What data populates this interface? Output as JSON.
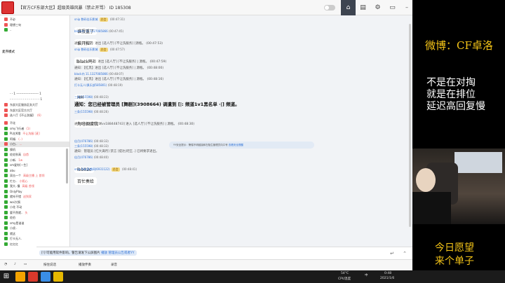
{
  "title": "【官方CF东部大区】超级英雄风暴（禁止开骂） ID 185308",
  "viewers": "5万",
  "tabs": [
    "home",
    "list",
    "tools",
    "info"
  ],
  "sidebar": {
    "top": [
      {
        "label": "不必",
        "icon": "#e55"
      },
      {
        "label": "理想三旬",
        "icon": "#e55"
      },
      {
        "label": "..",
        "icon": "#3a3"
      }
    ],
    "section_label": "麦序模式",
    "lines": [
      "- - 1 ---------------------- 1",
      "- - - - - - - - - - - - - - - - 1"
    ],
    "channels": [
      {
        "label": "东部大区服务区务大厅",
        "icon": "#e55"
      },
      {
        "label": "东部大区官方大厅",
        "icon": "#e55"
      },
      {
        "label": "选人厅【不让洗服】",
        "icon": "#e55",
        "note": "(6)"
      }
    ],
    "members": [
      {
        "label": "不化",
        "icon": "#e55"
      },
      {
        "label": "smy飞行者",
        "icon": "#3a3",
        "note": "(1)"
      },
      {
        "label": "PL拉K哦",
        "icon": "#3a3",
        "note": "不让洗服 [麦]"
      },
      {
        "label": "阿福.",
        "icon": "#3a3",
        "note": "(..)"
      },
      {
        "label": "小白..",
        "icon": "#e55",
        "note": "...",
        "selected": true
      },
      {
        "label": "操机",
        "icon": "#3a3"
      },
      {
        "label": "佐佐秋高",
        "icon": "#3a3",
        "note": "自首"
      },
      {
        "label": "小新.",
        "icon": "#3a3",
        "note": "1w"
      },
      {
        "label": "sm爱你[一生]",
        "icon": "#3a3"
      },
      {
        "label": "abu",
        "icon": "#3a3"
      },
      {
        "label": "双击一个",
        "icon": "#3a3",
        "note": "高级主播 上 首领"
      },
      {
        "label": "忙乜..",
        "icon": "#3a3",
        "note": "小熙心"
      },
      {
        "label": "我大..慢",
        "icon": "#3a3",
        "note": "高级 首领"
      },
      {
        "label": "OnlyPlay",
        "icon": "#3a3"
      },
      {
        "label": "就咔不错",
        "icon": "#3a3",
        "note": "送到家"
      },
      {
        "label": "wai大锅",
        "icon": "#3a3"
      },
      {
        "label": "小花 不动",
        "icon": "#3a3"
      },
      {
        "label": "要不然就..",
        "icon": "#3a3",
        "note": "头"
      },
      {
        "label": "佐伯",
        "icon": "#3a3"
      },
      {
        "label": "smy是谁谁",
        "icon": "#3a3"
      },
      {
        "label": "小虎..",
        "icon": "#3a3"
      },
      {
        "label": "就这",
        "icon": "#3a3"
      },
      {
        "label": "打卡无人.",
        "icon": "#3a3"
      },
      {
        "label": "红红红",
        "icon": "#3a3"
      }
    ]
  },
  "chat": {
    "messages": [
      {
        "type": "meta",
        "name": "snip 数码佳乐影城",
        "badge": "总会",
        "time": "00:47:31"
      },
      {
        "type": "bubble",
        "text": "谁授重了"
      },
      {
        "type": "meta",
        "name": "black内 11.1327085866",
        "time": "00:47:45"
      },
      {
        "type": "bubble",
        "text": "谁开拉？"
      },
      {
        "type": "sys",
        "text": "通知：【快乐】进出 [选人厅] [不让洗服务] [源瓶。 (00:47:53)"
      },
      {
        "type": "meta",
        "name": "snip 数码佳乐影城",
        "badge": "总会",
        "time": "00:47:57"
      },
      {
        "type": "bubble",
        "text": "black吗？"
      },
      {
        "type": "sys",
        "text": "【1 1 8 .. 2 q】进出 [选人厅] [不让洗服务] | 源瓶。 (00:47:59)"
      },
      {
        "type": "sys",
        "text": "通知：【红黑】进出 [选人厅] [不让洗服务] | 源瓶。 (00:48:00)"
      },
      {
        "type": "meta",
        "name": "black内 11.1327085866",
        "time": "00:48:07"
      },
      {
        "type": "sys",
        "text": "通知：【红黑】进出 [选人厅] [不让洗服务] | 源瓶。 (00:48:16)"
      },
      {
        "type": "meta",
        "name": "打卡无人(俱乐部585801)",
        "badge": "",
        "time": "00:48:19"
      },
      {
        "type": "bubble",
        "text": "HH"
      },
      {
        "type": "meta",
        "name": "三条(155598)",
        "time": "00:48:23"
      },
      {
        "type": "notice",
        "text": "通知：您已经被管理员 [舞剧](3908664) 调遣到 [|:     频道1v1黑名单      ·|] 频道。"
      },
      {
        "type": "meta",
        "name": "三条(155598)",
        "time": "00:48:26"
      },
      {
        "type": "bubble",
        "text": "为啥调度我"
      },
      {
        "type": "sys",
        "text": "通知：[进入CF全球vv188448743] 进入 [选人厅] [不让洗服务] | 源瓶。 (00:48:30)"
      },
      {
        "type": "meta",
        "name": "佳月(476786)",
        "time": "00:48:33"
      },
      {
        "type": "meta",
        "name": "三条(155598)",
        "time": "00:48:33"
      },
      {
        "type": "sys",
        "text": "通知：管理员 [红大满月] 禁言 [提达|吧王..] 已将要求退出。"
      },
      {
        "type": "meta",
        "name": "佳月(476786)",
        "time": "00:48:40"
      },
      {
        "type": "bubble",
        "text": "lbb02c"
      },
      {
        "type": "meta",
        "name": "snip-所有直播网(6931122)",
        "badge": "总会",
        "time": "00:48:41"
      },
      {
        "type": "bubble",
        "text": "百忙奏给"
      }
    ],
    "tip": {
      "prefix": "YY安全提示：警惕不明链接和在陌生管理员向口号",
      "link": "查看安全提醒"
    }
  },
  "input": {
    "tag_text": "[!]!可能用软件影响，警告请发下公屏图片",
    "tag_link": "播放 管理员公告或者YY"
  },
  "bottom": {
    "btn1": "按住说话",
    "btn2": "播放伴奏",
    "btn3": "录音"
  },
  "taskbar": {
    "temp": "54°C",
    "temp_label": "CPU温度",
    "time": "0:48",
    "date": "2021/1/6",
    "ime": "中"
  },
  "overlay": {
    "weibo": "微博：CF卓洛",
    "notes": [
      "不是在对掏",
      "就是在排位",
      "延迟高回复慢"
    ],
    "wish": [
      "今日愿望",
      "来个单子"
    ]
  }
}
